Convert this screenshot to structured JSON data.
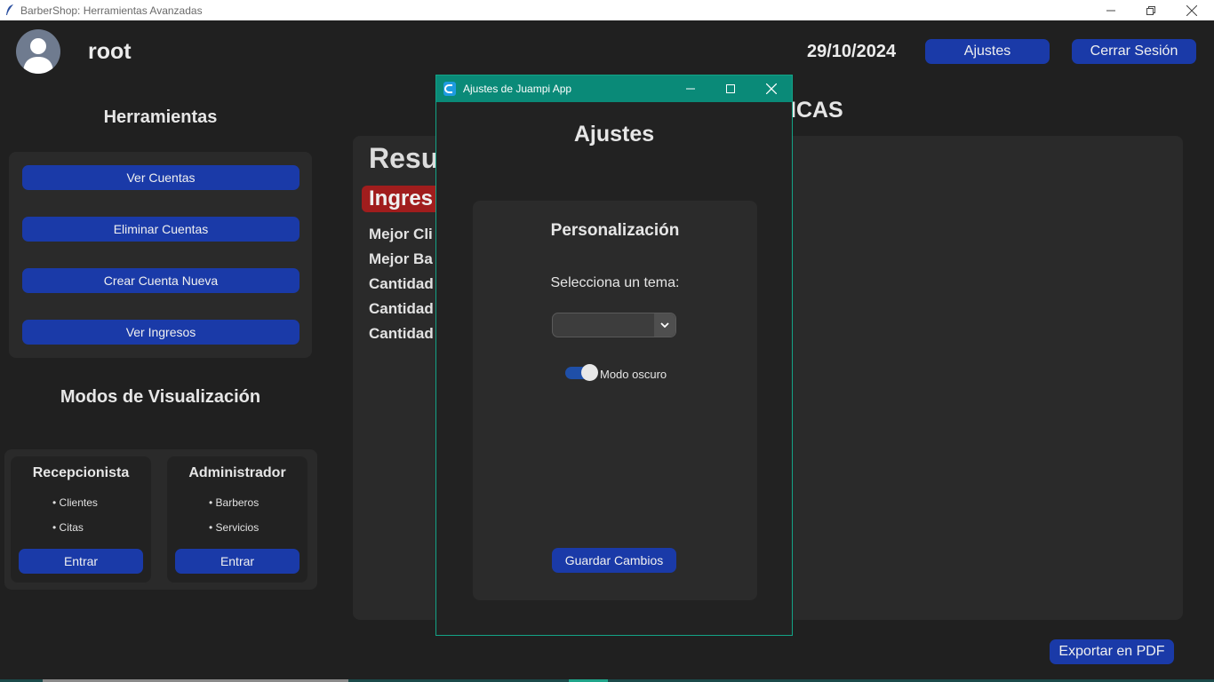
{
  "window": {
    "title": "BarberShop: Herramientas Avanzadas"
  },
  "header": {
    "username": "root",
    "date": "29/10/2024",
    "settings_label": "Ajustes",
    "logout_label": "Cerrar Sesión"
  },
  "tools": {
    "title": "Herramientas",
    "buttons": [
      "Ver Cuentas",
      "Eliminar Cuentas",
      "Crear Cuenta Nueva",
      "Ver Ingresos"
    ]
  },
  "modes": {
    "title": "Modos de Visualización",
    "roles": [
      {
        "title": "Recepcionista",
        "items": [
          "• Clientes",
          "• Citas"
        ],
        "button": "Entrar"
      },
      {
        "title": "Administrador",
        "items": [
          "• Barberos",
          "• Servicios"
        ],
        "button": "Entrar"
      }
    ]
  },
  "stats": {
    "header_fragment": "ICAS",
    "title_fragment": "Resu",
    "badge_fragment": "Ingres",
    "lines": [
      "Mejor Cli",
      "Mejor Ba",
      "Cantidad",
      "Cantidad",
      "Cantidad"
    ]
  },
  "dialog": {
    "title": "Ajustes de Juampi App",
    "heading": "Ajustes",
    "section": "Personalización",
    "theme_label": "Selecciona un tema:",
    "theme_value": "",
    "dark_mode_label": "Modo oscuro",
    "dark_mode_on": true,
    "save_label": "Guardar Cambios"
  },
  "footer": {
    "export_label": "Exportar en PDF"
  },
  "colors": {
    "button": "#1a3aa8",
    "dialog_titlebar": "#0a8a78",
    "badge": "#a01d1d",
    "background": "#202020"
  }
}
